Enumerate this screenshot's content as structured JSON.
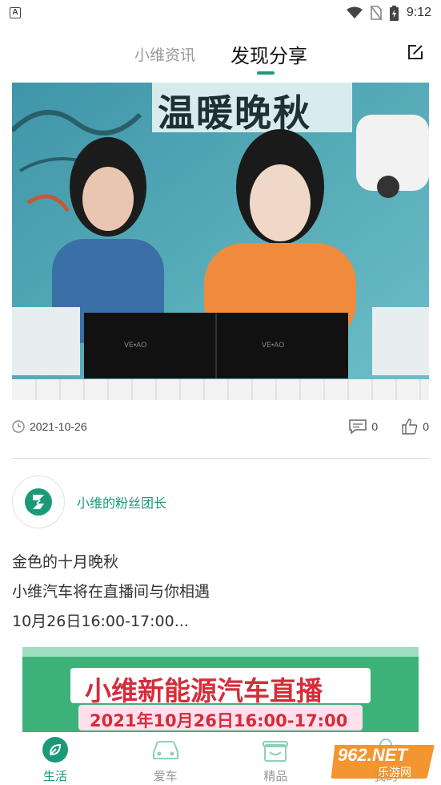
{
  "status_bar": {
    "notification_icon": "A",
    "time": "9:12",
    "icons": [
      "wifi-icon",
      "no-sim-icon",
      "battery-charging-icon"
    ]
  },
  "header": {
    "tabs": [
      {
        "label": "小维资讯",
        "active": false
      },
      {
        "label": "发现分享",
        "active": true
      }
    ],
    "edit_icon": "edit-icon",
    "accent_color": "#1a9a78"
  },
  "post": {
    "media": {
      "headline": "温暖晚秋",
      "box_logo": "VE•AO"
    },
    "date": "2021-10-26",
    "comment_count": "0",
    "like_count": "0"
  },
  "feed_item": {
    "author_name": "小维的粉丝团长",
    "lines": [
      "金色的十月晚秋",
      "小维汽车将在直播间与你相遇",
      "10月26日16:00-17:00..."
    ],
    "banner": {
      "title": "小维新能源汽车直播",
      "subtitle": "2021年10月26日16:00-17:00"
    }
  },
  "bottom_nav": [
    {
      "label": "生活",
      "icon": "leaf-icon",
      "active": true
    },
    {
      "label": "爱车",
      "icon": "car-icon",
      "active": false
    },
    {
      "label": "精品",
      "icon": "gift-icon",
      "active": false
    },
    {
      "label": "我的",
      "icon": "profile-icon",
      "active": false
    }
  ],
  "watermark": {
    "text": "962.NET",
    "subtext": "乐游网"
  }
}
